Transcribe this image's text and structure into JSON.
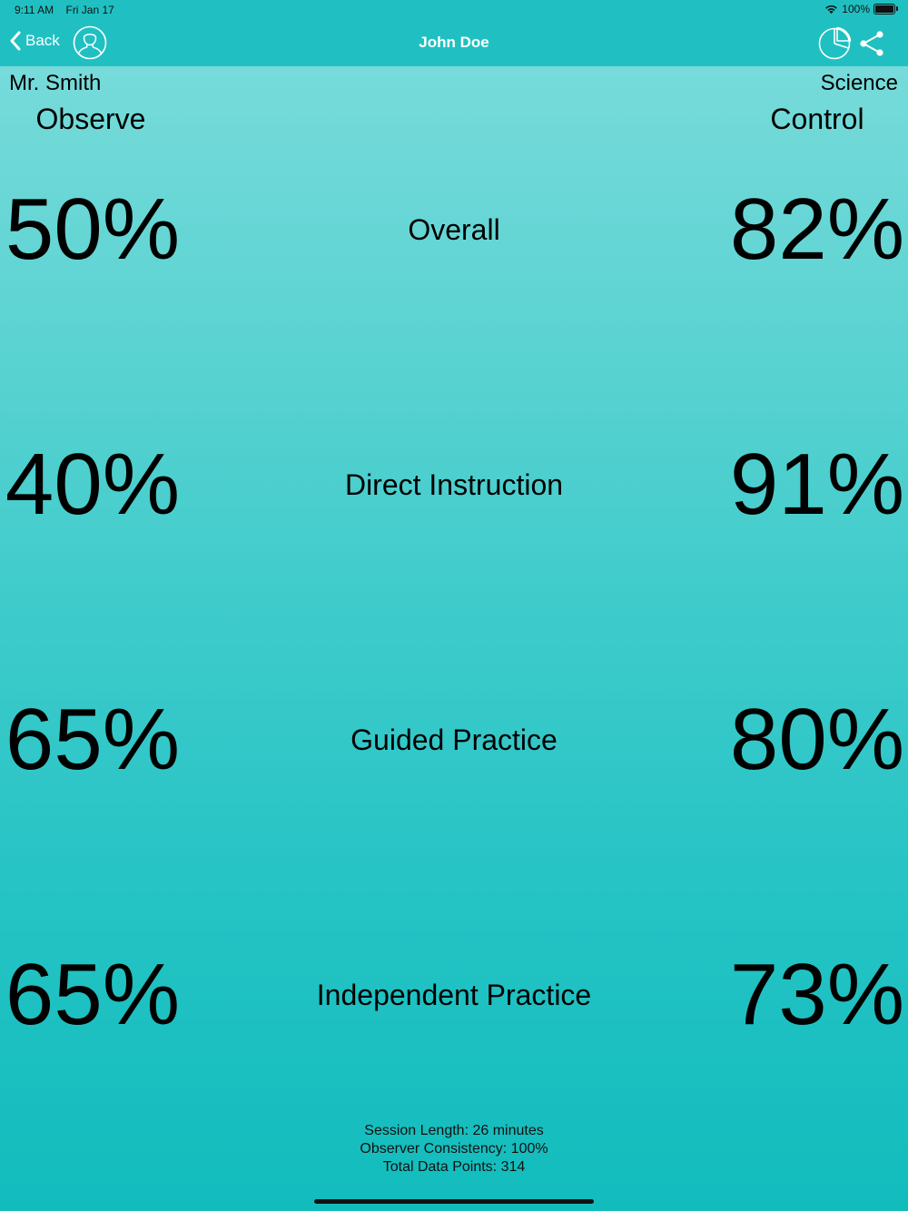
{
  "status_bar": {
    "time": "9:11 AM",
    "date": "Fri Jan 17",
    "battery": "100%"
  },
  "nav": {
    "back_label": "Back",
    "title": "John Doe",
    "icons": [
      "chevron-left-icon",
      "person-icon",
      "pie-chart-icon",
      "share-icon"
    ]
  },
  "header": {
    "teacher": "Mr. Smith",
    "subject": "Science",
    "left_mode": "Observe",
    "right_mode": "Control"
  },
  "rows": [
    {
      "label": "Overall",
      "observe": "50%",
      "control": "82%"
    },
    {
      "label": "Direct Instruction",
      "observe": "40%",
      "control": "91%"
    },
    {
      "label": "Guided Practice",
      "observe": "65%",
      "control": "80%"
    },
    {
      "label": "Independent Practice",
      "observe": "65%",
      "control": "73%"
    }
  ],
  "footer": {
    "session_length": "Session Length: 26 minutes",
    "observer_consistency": "Observer Consistency: 100%",
    "total_data_points": "Total Data Points: 314"
  },
  "colors": {
    "nav_bar": "#20c0c2",
    "gradient_top": "#7ddddc",
    "gradient_bottom": "#12bcbd",
    "nav_text": "#ffffff",
    "body_text": "#000000"
  }
}
